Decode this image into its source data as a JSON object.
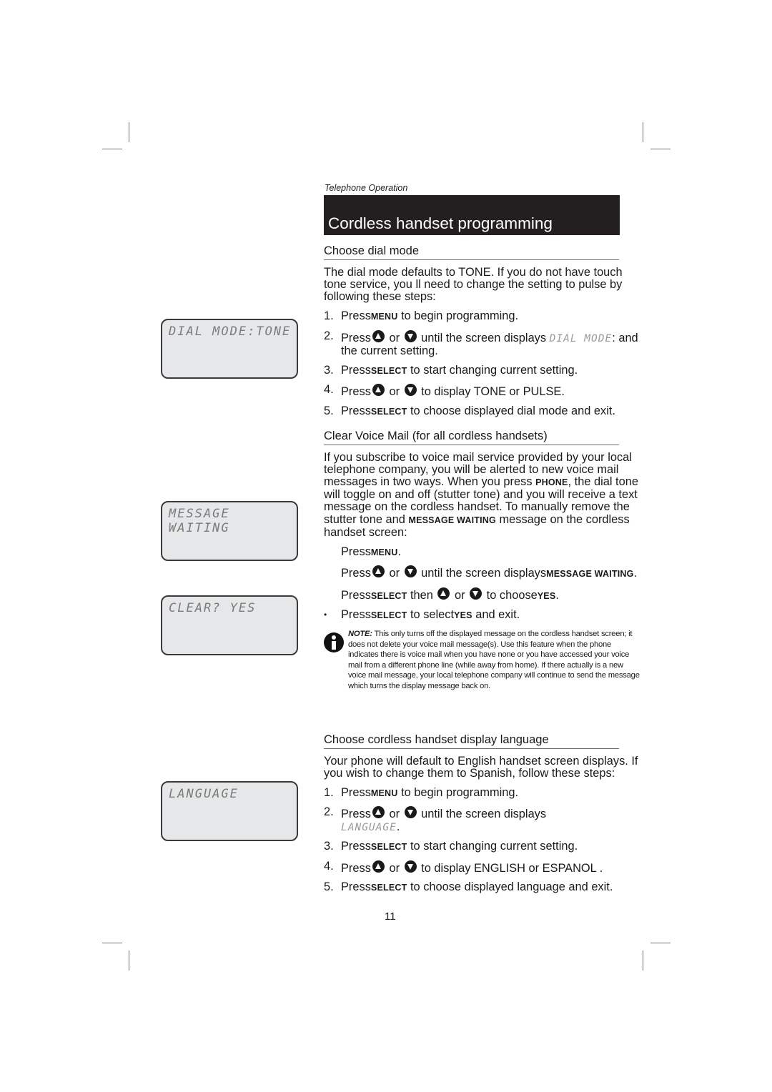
{
  "running_head": "Telephone Operation",
  "title": "Cordless handset programming",
  "sections": {
    "dial_mode": {
      "heading": "Choose dial mode",
      "intro": "The dial mode defaults to TONE. If you do not have touch tone service, you ll need to change the setting to pulse by following these steps:",
      "steps": [
        {
          "num": "1.",
          "pre": "Press",
          "key": "MENU",
          "post": " to begin programming."
        },
        {
          "num": "2.",
          "pre": "Press",
          "or": " or ",
          "post": " until the screen displays ",
          "lcd": "DIAL MODE",
          "post2": ": and the current setting."
        },
        {
          "num": "3.",
          "pre": "Press",
          "key": "SELECT",
          "post": " to start changing current setting."
        },
        {
          "num": "4.",
          "pre": "Press",
          "or": " or ",
          "post": " to display TONE or PULSE."
        },
        {
          "num": "5.",
          "pre": "Press",
          "key": "SELECT",
          "post": " to choose displayed dial mode and exit."
        }
      ]
    },
    "voice_mail": {
      "heading": "Clear Voice Mail (for all cordless handsets)",
      "intro_1": "If you subscribe to voice mail service provided by your local telephone company, you will be alerted to new voice mail messages in two ways. When you press ",
      "intro_key1": "PHONE",
      "intro_2": ", the dial tone will toggle on and off (stutter tone) and you will receive a text message on the cordless handset. To manually remove the stutter tone and ",
      "intro_key2": "MESSAGE WAITING",
      "intro_3": " message on the cordless handset screen:",
      "steps": [
        {
          "pre": "Press",
          "key": "MENU",
          "post": "."
        },
        {
          "pre": "Press",
          "or": " or ",
          "post": " until the screen displays",
          "key": "MESSAGE WAITING",
          "post2": "."
        },
        {
          "pre": "Press",
          "key": "SELECT",
          "mid": " then ",
          "or": " or ",
          "post": " to choose",
          "key2": "YES",
          "post2": "."
        },
        {
          "bullet": "•",
          "pre": "Press",
          "key": "SELECT",
          "mid": " to select",
          "key2": "YES",
          "post": " and exit."
        }
      ],
      "note_label": "NOTE:",
      "note_text": " This only turns off the displayed message on the cordless handset screen; it does not delete your voice mail message(s). Use this feature when the phone indicates there is voice mail when you have none or you have accessed your voice mail from a different phone line (while away from home). If there actually is a new voice mail message, your local telephone company will continue to send the message which turns the display message back on."
    },
    "language": {
      "heading": "Choose cordless handset display language",
      "intro": "Your phone will default to English handset screen displays. If you wish to change them to Spanish, follow these steps:",
      "steps": [
        {
          "num": "1.",
          "pre": "Press",
          "key": "MENU",
          "post": " to begin programming."
        },
        {
          "num": "2.",
          "pre": "Press",
          "or": " or ",
          "post": " until the screen displays",
          "lcd": "LANGUAGE",
          "post2": "."
        },
        {
          "num": "3.",
          "pre": "Press",
          "key": "SELECT",
          "post": " to start changing current setting."
        },
        {
          "num": "4.",
          "pre": "Press",
          "or": " or ",
          "post": " to display ENGLISH or ESPANOL ."
        },
        {
          "num": "5.",
          "pre": "Press",
          "key": "SELECT",
          "post": " to choose displayed language and exit."
        }
      ]
    }
  },
  "lcd_screens": [
    {
      "text": "DIAL MODE:TONE"
    },
    {
      "text": "MESSAGE WAITING"
    },
    {
      "text": "CLEAR? YES"
    },
    {
      "text": "LANGUAGE"
    }
  ],
  "icons": {
    "up": "up-arrow-button-icon",
    "down": "down-arrow-button-icon",
    "note": "info-icon"
  },
  "page_number": "11"
}
